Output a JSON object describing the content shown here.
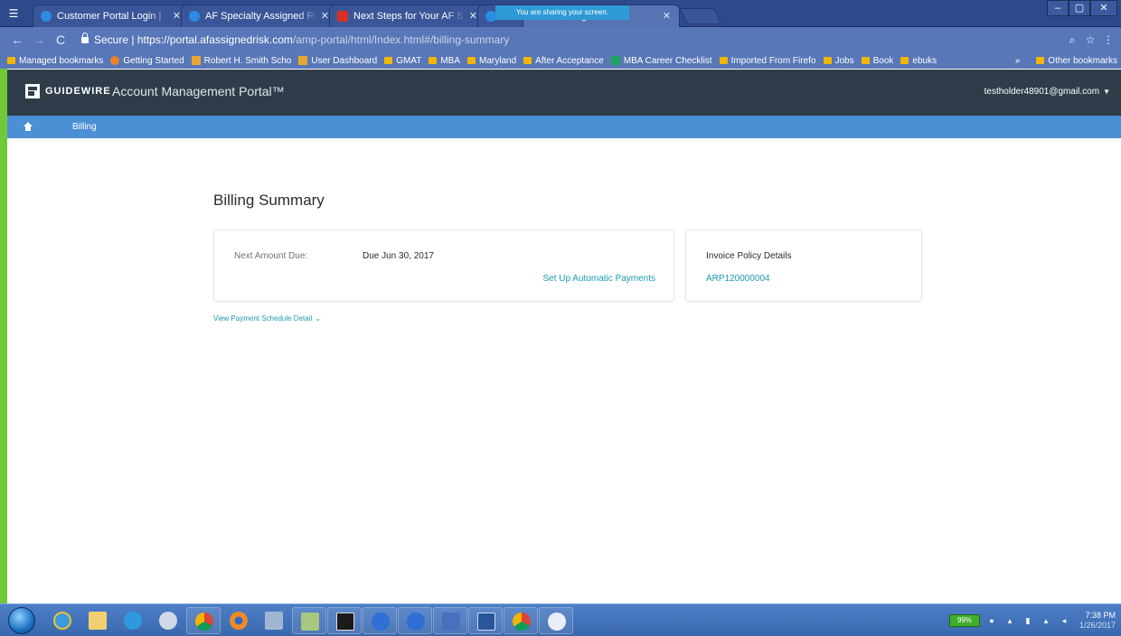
{
  "browser": {
    "tabs": [
      {
        "title": "Customer Portal Login | ",
        "icon": "portal-favicon",
        "active": false
      },
      {
        "title": "AF Specialty Assigned Ri",
        "icon": "portal-favicon",
        "active": false
      },
      {
        "title": "Next Steps for Your AF S",
        "icon": "gmail-favicon",
        "active": false
      },
      {
        "title": "Cus",
        "icon": "portal-favicon",
        "active": false
      },
      {
        "title": "ount Management P",
        "icon": "portal-favicon",
        "active": true
      }
    ],
    "share_banner": "You are sharing your screen.",
    "window_controls": {
      "minimize": "–",
      "maximize": "▢",
      "close": "✕"
    },
    "omnibox": {
      "secure_label": "Secure",
      "url_host": "https://portal.afassignedrisk.com",
      "url_path": "/amp-portal/html/Index.html#/billing-summary"
    },
    "bookmarks": [
      {
        "label": "Managed bookmarks",
        "icon": "folder-icon"
      },
      {
        "label": "Getting Started",
        "icon": "firefox-icon"
      },
      {
        "label": "Robert H. Smith Scho",
        "icon": "school-icon"
      },
      {
        "label": "User Dashboard",
        "icon": "school-icon"
      },
      {
        "label": "GMAT",
        "icon": "folder-icon"
      },
      {
        "label": "MBA",
        "icon": "folder-icon"
      },
      {
        "label": "Maryland",
        "icon": "folder-icon"
      },
      {
        "label": "After Acceptance",
        "icon": "folder-icon"
      },
      {
        "label": "MBA Career Checklist",
        "icon": "sheets-icon"
      },
      {
        "label": "Imported From Firefo",
        "icon": "folder-icon"
      },
      {
        "label": "Jobs",
        "icon": "folder-icon"
      },
      {
        "label": "Book",
        "icon": "folder-icon"
      },
      {
        "label": "ebuks",
        "icon": "folder-icon"
      }
    ],
    "bookmarks_overflow": "»",
    "other_bookmarks": "Other bookmarks"
  },
  "portal": {
    "brand": "GUIDEWIRE",
    "product": "Account Management Portal™",
    "user_email": "testholder48901@gmail.com",
    "breadcrumb": "Billing",
    "page_title": "Billing Summary",
    "next_amount_due_label": "Next Amount Due:",
    "next_amount_due_value": "Due Jun 30, 2017",
    "auto_payments_link": "Set Up Automatic Payments",
    "invoice_title": "Invoice Policy Details",
    "invoice_policy_number": "ARP120000004",
    "schedule_link": "View Payment Schedule Detail",
    "colors": {
      "header_bg": "#2f3d4a",
      "crumb_bg": "#4b8fd4",
      "link": "#1a9bb0"
    }
  },
  "taskbar": {
    "apps": [
      "internet-explorer-icon",
      "folder-icon",
      "people-icon",
      "clock-icon",
      "chrome-app-icon",
      "firefox-icon",
      "tool-icon",
      "paint-icon",
      "cmd-icon",
      "google-icon",
      "google-icon",
      "user-icon",
      "word-icon",
      "chrome-icon",
      "snipping-tool-icon"
    ],
    "battery": "99%",
    "time": "7:38 PM",
    "date": "1/26/2017"
  }
}
